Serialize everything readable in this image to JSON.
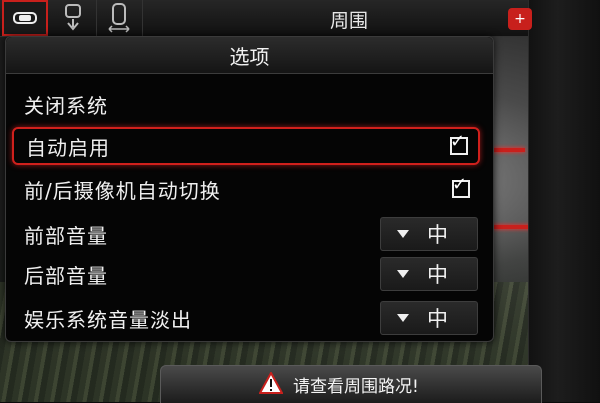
{
  "topbar": {
    "title": "周围",
    "view_buttons": [
      {
        "icon": "car-top-view-icon",
        "active": true
      },
      {
        "icon": "car-rear-camera-icon",
        "active": false
      },
      {
        "icon": "car-side-view-icon",
        "active": false
      }
    ],
    "red_button_icon": "plus-icon"
  },
  "dialog": {
    "title": "选项",
    "items": [
      {
        "label": "关闭系统",
        "type": "action"
      },
      {
        "label": "自动启用",
        "type": "checkbox",
        "checked": true,
        "selected": true
      },
      {
        "label": "前/后摄像机自动切换",
        "type": "checkbox",
        "checked": true
      },
      {
        "label": "前部音量",
        "type": "dropdown",
        "value": "中"
      },
      {
        "label": "后部音量",
        "type": "dropdown",
        "value": "中"
      },
      {
        "label": "娱乐系统音量淡出",
        "type": "dropdown",
        "value": "中"
      }
    ]
  },
  "warning": {
    "icon": "warning-triangle-icon",
    "text": "请查看周围路况!"
  },
  "colors": {
    "accent_red": "#c8201c",
    "dialog_bg": "#050505",
    "text": "#f0f0f0"
  }
}
